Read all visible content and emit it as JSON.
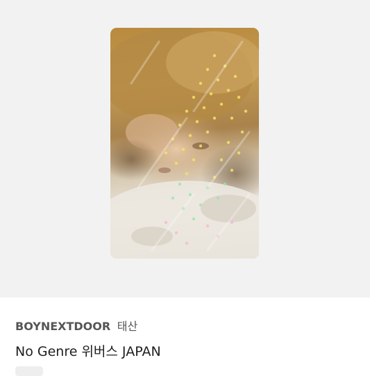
{
  "product": {
    "artist": "BOYNEXTDOOR",
    "member": "태산",
    "title": "No Genre 위버스 JAPAN"
  },
  "colors": {
    "hero_background": "#f2f2f2",
    "artist_text": "#555555",
    "title_text": "#1e1e1e"
  }
}
